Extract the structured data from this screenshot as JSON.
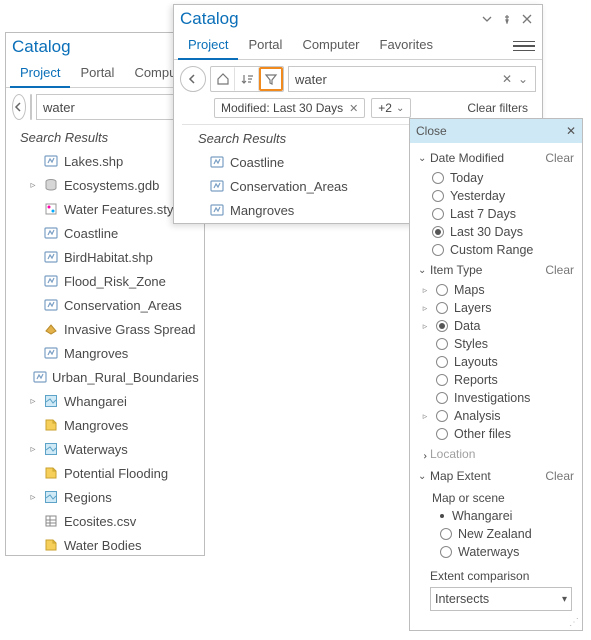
{
  "leftPane": {
    "title": "Catalog",
    "tabs": [
      "Project",
      "Portal",
      "Computer"
    ],
    "activeTab": 0,
    "search": {
      "value": "water"
    },
    "resultsHeader": "Search Results",
    "items": [
      {
        "label": "Lakes.shp",
        "icon": "feature-class",
        "expander": ""
      },
      {
        "label": "Ecosystems.gdb",
        "icon": "geodatabase",
        "expander": "▹"
      },
      {
        "label": "Water Features.stylx",
        "icon": "style-file",
        "expander": ""
      },
      {
        "label": "Coastline",
        "icon": "feature-class",
        "expander": ""
      },
      {
        "label": "BirdHabitat.shp",
        "icon": "feature-class",
        "expander": ""
      },
      {
        "label": "Flood_Risk_Zone",
        "icon": "feature-class",
        "expander": ""
      },
      {
        "label": "Conservation_Areas",
        "icon": "feature-class",
        "expander": ""
      },
      {
        "label": "Invasive Grass Spread",
        "icon": "layer-poly",
        "expander": ""
      },
      {
        "label": "Mangroves",
        "icon": "feature-class",
        "expander": ""
      },
      {
        "label": "Urban_Rural_Boundaries",
        "icon": "feature-class",
        "expander": ""
      },
      {
        "label": "Whangarei",
        "icon": "map",
        "expander": "▹"
      },
      {
        "label": "Mangroves",
        "icon": "layout",
        "expander": ""
      },
      {
        "label": "Waterways",
        "icon": "map",
        "expander": "▹"
      },
      {
        "label": "Potential Flooding",
        "icon": "layout",
        "expander": ""
      },
      {
        "label": "Regions",
        "icon": "map",
        "expander": "▹"
      },
      {
        "label": "Ecosites.csv",
        "icon": "table-csv",
        "expander": ""
      },
      {
        "label": "Water Bodies",
        "icon": "layout",
        "expander": ""
      }
    ]
  },
  "rightPane": {
    "title": "Catalog",
    "tabs": [
      "Project",
      "Portal",
      "Computer",
      "Favorites"
    ],
    "activeTab": 0,
    "search": {
      "value": "water"
    },
    "chip": {
      "label": "Modified: Last 30 Days"
    },
    "chipDropdown": "+2",
    "clearFilters": "Clear filters",
    "resultsHeader": "Search Results",
    "items": [
      {
        "label": "Coastline",
        "icon": "feature-class"
      },
      {
        "label": "Conservation_Areas",
        "icon": "feature-class"
      },
      {
        "label": "Mangroves",
        "icon": "feature-class"
      }
    ]
  },
  "filters": {
    "closeLabel": "Close",
    "sections": {
      "dateModified": {
        "title": "Date Modified",
        "clear": "Clear",
        "options": [
          {
            "label": "Today",
            "checked": false
          },
          {
            "label": "Yesterday",
            "checked": false
          },
          {
            "label": "Last 7 Days",
            "checked": false
          },
          {
            "label": "Last 30 Days",
            "checked": true
          },
          {
            "label": "Custom Range",
            "checked": false
          }
        ]
      },
      "itemType": {
        "title": "Item Type",
        "clear": "Clear",
        "options": [
          {
            "label": "Maps",
            "checked": false,
            "expandable": true
          },
          {
            "label": "Layers",
            "checked": false,
            "expandable": true
          },
          {
            "label": "Data",
            "checked": true,
            "expandable": true
          },
          {
            "label": "Styles",
            "checked": false,
            "expandable": false
          },
          {
            "label": "Layouts",
            "checked": false,
            "expandable": false
          },
          {
            "label": "Reports",
            "checked": false,
            "expandable": false
          },
          {
            "label": "Investigations",
            "checked": false,
            "expandable": false
          },
          {
            "label": "Analysis",
            "checked": false,
            "expandable": true
          },
          {
            "label": "Other files",
            "checked": false,
            "expandable": false
          }
        ]
      },
      "location": {
        "title": "Location"
      },
      "mapExtent": {
        "title": "Map Extent",
        "clear": "Clear",
        "groupLabel": "Map or scene",
        "options": [
          {
            "label": "Whangarei",
            "selected": true
          },
          {
            "label": "New Zealand",
            "selected": false
          },
          {
            "label": "Waterways",
            "selected": false
          }
        ],
        "compareLabel": "Extent comparison",
        "compareValue": "Intersects"
      }
    }
  }
}
